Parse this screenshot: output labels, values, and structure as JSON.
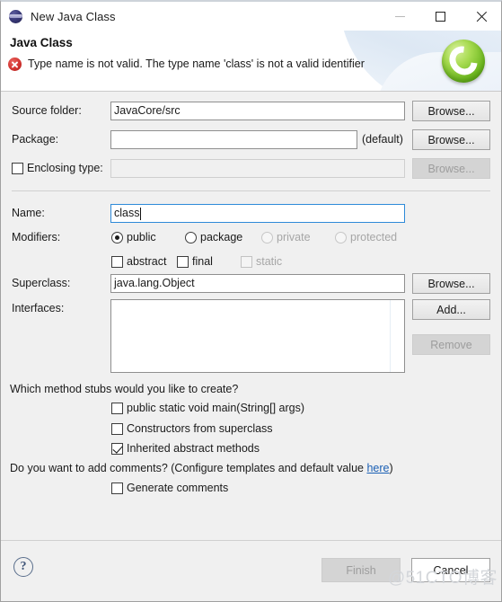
{
  "window": {
    "title": "New Java Class",
    "icon": "eclipse-globe-icon",
    "controls": {
      "minimize": "minimize-icon",
      "maximize": "maximize-icon",
      "close": "close-icon"
    }
  },
  "header": {
    "title": "Java Class",
    "message": "Type name is not valid. The type name 'class' is not a valid identifier",
    "message_icon": "error-icon",
    "wizard_icon": "java-class-wizard-icon",
    "error_color": "#d0312d",
    "accent_color": "#6cb71f"
  },
  "form": {
    "source_folder": {
      "label": "Source folder:",
      "value": "JavaCore/src",
      "button": "Browse..."
    },
    "package": {
      "label": "Package:",
      "value": "",
      "suffix": "(default)",
      "button": "Browse..."
    },
    "enclosing_type": {
      "label": "Enclosing type:",
      "checked": false,
      "value": "",
      "button": "Browse...",
      "disabled": true
    },
    "name": {
      "label": "Name:",
      "value": "class",
      "focused": true
    },
    "modifiers": {
      "label": "Modifiers:",
      "radios": [
        {
          "label": "public",
          "selected": true,
          "disabled": false
        },
        {
          "label": "package",
          "selected": false,
          "disabled": false
        },
        {
          "label": "private",
          "selected": false,
          "disabled": true
        },
        {
          "label": "protected",
          "selected": false,
          "disabled": true
        }
      ],
      "checkboxes": [
        {
          "label": "abstract",
          "checked": false,
          "disabled": false
        },
        {
          "label": "final",
          "checked": false,
          "disabled": false
        },
        {
          "label": "static",
          "checked": false,
          "disabled": true
        }
      ]
    },
    "superclass": {
      "label": "Superclass:",
      "value": "java.lang.Object",
      "button": "Browse..."
    },
    "interfaces": {
      "label": "Interfaces:",
      "items": [],
      "add_button": "Add...",
      "remove_button": "Remove",
      "remove_disabled": true
    }
  },
  "stubs": {
    "question": "Which method stubs would you like to create?",
    "options": [
      {
        "label": "public static void main(String[] args)",
        "checked": false
      },
      {
        "label": "Constructors from superclass",
        "checked": false
      },
      {
        "label": "Inherited abstract methods",
        "checked": true
      }
    ]
  },
  "comments": {
    "question_prefix": "Do you want to add comments? (Configure templates and default value ",
    "link": "here",
    "question_suffix": ")",
    "option": {
      "label": "Generate comments",
      "checked": false
    }
  },
  "footer": {
    "help_icon": "help-question-icon",
    "finish_button": "Finish",
    "finish_disabled": true,
    "cancel_button": "Cancel",
    "watermark": "@51CTO博客"
  }
}
